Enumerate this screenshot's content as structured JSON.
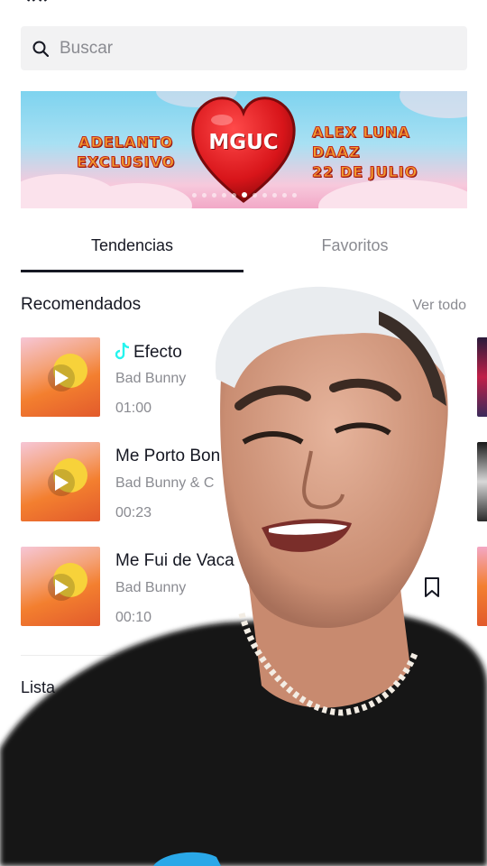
{
  "search": {
    "placeholder": "Buscar"
  },
  "banner": {
    "left_line1": "ADELANTO",
    "left_line2": "EXCLUSIVO",
    "center": "MGUC",
    "right_line1": "ALEX LUNA",
    "right_line2": "DAAZ",
    "right_line3": "22 DE JULIO"
  },
  "tabs": [
    {
      "label": "Tendencias",
      "active": true
    },
    {
      "label": "Favoritos",
      "active": false
    }
  ],
  "section": {
    "title": "Recomendados",
    "see_all": "Ver todo"
  },
  "tracks": [
    {
      "title": "Efecto",
      "artist": "Bad Bunny",
      "duration": "01:00"
    },
    {
      "title": "Me Porto Bon",
      "artist": "Bad Bunny & C",
      "duration": "00:23"
    },
    {
      "title": "Me Fui de Vaca",
      "artist": "Bad Bunny",
      "duration": "00:10"
    }
  ],
  "list_section": {
    "label": "Lista"
  },
  "colors": {
    "accent_tiktok": "#25f4ee",
    "text": "#161823",
    "muted": "#8a8b91"
  }
}
